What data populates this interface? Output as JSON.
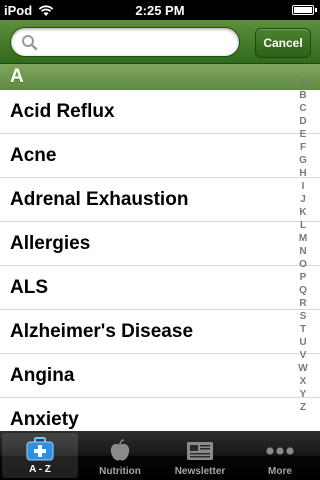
{
  "status_bar": {
    "carrier": "iPod",
    "time": "2:25 PM"
  },
  "search": {
    "placeholder": "",
    "value": "",
    "cancel_label": "Cancel"
  },
  "list": {
    "section": "A",
    "items": [
      "Acid Reflux",
      "Acne",
      "Adrenal Exhaustion",
      "Allergies",
      "ALS",
      "Alzheimer's Disease",
      "Angina",
      "Anxiety"
    ]
  },
  "index": [
    "A",
    "B",
    "C",
    "D",
    "E",
    "F",
    "G",
    "H",
    "I",
    "J",
    "K",
    "L",
    "M",
    "N",
    "O",
    "P",
    "Q",
    "R",
    "S",
    "T",
    "U",
    "V",
    "W",
    "X",
    "Y",
    "Z"
  ],
  "tabs": [
    {
      "label": "A - Z",
      "icon": "medical-kit-icon",
      "active": true
    },
    {
      "label": "Nutrition",
      "icon": "apple-icon",
      "active": false
    },
    {
      "label": "Newsletter",
      "icon": "newspaper-icon",
      "active": false
    },
    {
      "label": "More",
      "icon": "more-dots-icon",
      "active": false
    }
  ],
  "colors": {
    "accent_green": "#4a7c2a",
    "section_green": "#6f9850",
    "tab_active_blue": "#3aa0e8"
  }
}
